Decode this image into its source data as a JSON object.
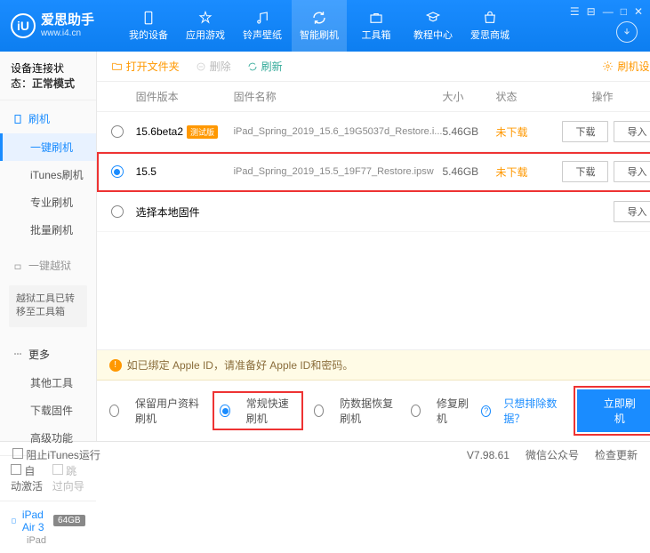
{
  "app": {
    "name": "爱思助手",
    "url": "www.i4.cn"
  },
  "nav": [
    {
      "label": "我的设备"
    },
    {
      "label": "应用游戏"
    },
    {
      "label": "铃声壁纸"
    },
    {
      "label": "智能刷机"
    },
    {
      "label": "工具箱"
    },
    {
      "label": "教程中心"
    },
    {
      "label": "爱思商城"
    }
  ],
  "status": {
    "prefix": "设备连接状态：",
    "value": "正常模式"
  },
  "sidebar": {
    "flash": {
      "head": "刷机",
      "items": [
        "一键刷机",
        "iTunes刷机",
        "专业刷机",
        "批量刷机"
      ]
    },
    "jailbreak": {
      "head": "一键越狱",
      "notice": "越狱工具已转移至工具箱"
    },
    "more": {
      "head": "更多",
      "items": [
        "其他工具",
        "下载固件",
        "高级功能"
      ]
    },
    "checks": {
      "auto": "自动激活",
      "skip": "跳过向导"
    }
  },
  "device": {
    "name": "iPad Air 3",
    "storage": "64GB",
    "type": "iPad"
  },
  "toolbar": {
    "open": "打开文件夹",
    "delete": "删除",
    "refresh": "刷新",
    "settings": "刷机设置"
  },
  "table": {
    "headers": {
      "ver": "固件版本",
      "name": "固件名称",
      "size": "大小",
      "status": "状态",
      "ops": "操作"
    },
    "rows": [
      {
        "ver": "15.6beta2",
        "beta": "测试版",
        "name": "iPad_Spring_2019_15.6_19G5037d_Restore.i...",
        "size": "5.46GB",
        "status": "未下载",
        "sel": false
      },
      {
        "ver": "15.5",
        "name": "iPad_Spring_2019_15.5_19F77_Restore.ipsw",
        "size": "5.46GB",
        "status": "未下载",
        "sel": true
      }
    ],
    "local": "选择本地固件",
    "download": "下载",
    "import": "导入"
  },
  "alert": "如已绑定 Apple ID，请准备好 Apple ID和密码。",
  "options": {
    "keep": "保留用户资料刷机",
    "normal": "常规快速刷机",
    "recover": "防数据恢复刷机",
    "repair": "修复刷机",
    "exclude": "只想排除数据？",
    "go": "立即刷机"
  },
  "footer": {
    "block": "阻止iTunes运行",
    "ver": "V7.98.61",
    "wechat": "微信公众号",
    "update": "检查更新"
  }
}
